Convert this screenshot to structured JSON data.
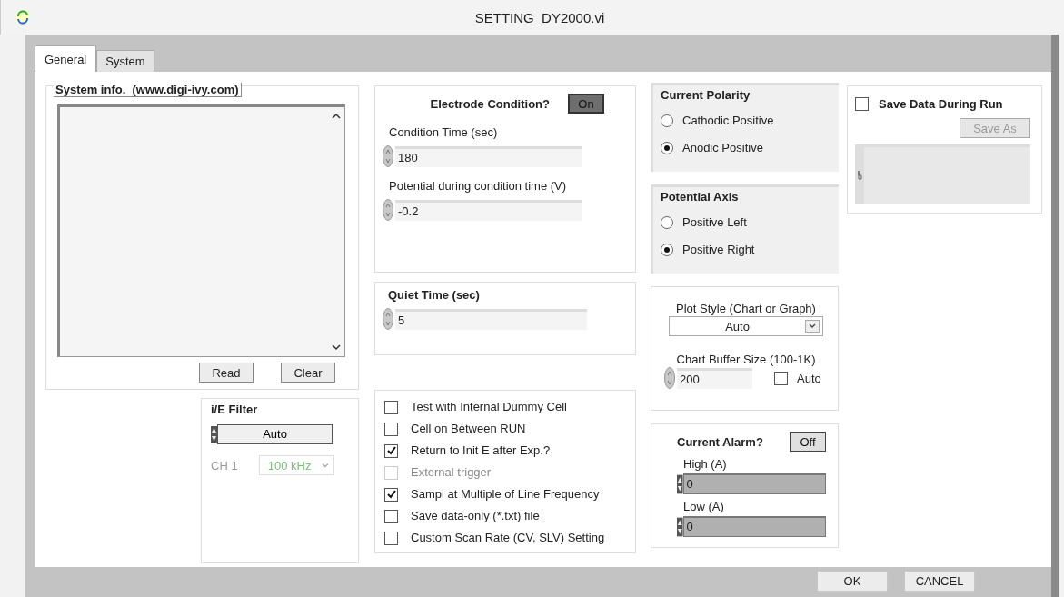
{
  "window": {
    "title": "SETTING_DY2000.vi"
  },
  "tabs": [
    {
      "label": "General",
      "selected": true
    },
    {
      "label": "System",
      "selected": false
    }
  ],
  "system_info": {
    "title": "System info.  (www.digi-ivy.com)",
    "buttons": [
      "Read",
      "Clear"
    ]
  },
  "ie_filter": {
    "title": "i/E Filter",
    "mode": "Auto",
    "channel_label": "CH 1",
    "channel_value": "100 kHz",
    "channel_disabled": true
  },
  "electrode": {
    "title": "Electrode Condition?",
    "toggle": {
      "label": "On",
      "on": true
    },
    "fields": [
      {
        "label": "Condition Time (sec)",
        "value": "180"
      },
      {
        "label": "Potential during condition time (V)",
        "value": "-0.2"
      }
    ]
  },
  "quiet_time": {
    "label": "Quiet Time (sec)",
    "value": "5"
  },
  "options": [
    {
      "label": "Test with Internal Dummy Cell",
      "checked": false,
      "disabled": false
    },
    {
      "label": "Cell on Between RUN",
      "checked": false,
      "disabled": false
    },
    {
      "label": "Return to Init E after Exp.?",
      "checked": true,
      "disabled": false
    },
    {
      "label": "External trigger",
      "checked": false,
      "disabled": true
    },
    {
      "label": "Sampl at Multiple of Line Frequency",
      "checked": true,
      "disabled": false
    },
    {
      "label": "Save data-only (*.txt) file",
      "checked": false,
      "disabled": false
    },
    {
      "label": "Custom Scan Rate (CV, SLV) Setting",
      "checked": false,
      "disabled": false
    }
  ],
  "radio_groups": [
    {
      "title": "Current Polarity",
      "options": [
        {
          "label": "Cathodic Positive",
          "selected": false
        },
        {
          "label": "Anodic Positive",
          "selected": true
        }
      ]
    },
    {
      "title": "Potential Axis",
      "options": [
        {
          "label": "Positive Left",
          "selected": false
        },
        {
          "label": "Positive Right",
          "selected": true
        }
      ]
    }
  ],
  "plot": {
    "style_label": "Plot Style (Chart or Graph)",
    "style_value": "Auto",
    "buffer_label": "Chart Buffer Size (100-1K)",
    "buffer_value": "200",
    "auto": {
      "label": "Auto",
      "checked": false
    }
  },
  "current_alarm": {
    "title": "Current Alarm?",
    "toggle": {
      "label": "Off",
      "on": false
    },
    "fields": [
      {
        "label": "High (A)",
        "value": "0"
      },
      {
        "label": "Low (A)",
        "value": "0"
      }
    ]
  },
  "save_data": {
    "label": "Save Data During Run",
    "checked": false,
    "button": "Save As",
    "button_disabled": true
  },
  "dialog_buttons": [
    "OK",
    "CANCEL"
  ]
}
